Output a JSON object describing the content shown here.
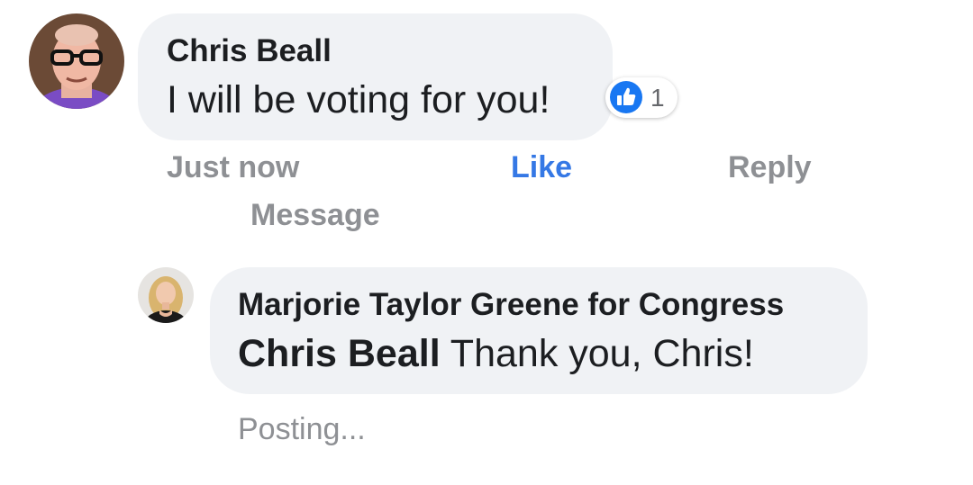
{
  "comment": {
    "author": "Chris Beall",
    "text": "I will be voting for you!",
    "reaction_count": "1",
    "timestamp": "Just now",
    "actions": {
      "like": "Like",
      "reply": "Reply",
      "message": "Message"
    }
  },
  "reply": {
    "author": "Marjorie Taylor Greene for Congress",
    "mention": "Chris Beall",
    "text": " Thank you, Chris!",
    "status": "Posting..."
  },
  "colors": {
    "bubble": "#f0f2f5",
    "like_blue": "#3578e5",
    "meta_gray": "#8e9094",
    "text_dark": "#1c1e21"
  },
  "icons": {
    "reaction": "thumbs-up-icon"
  }
}
